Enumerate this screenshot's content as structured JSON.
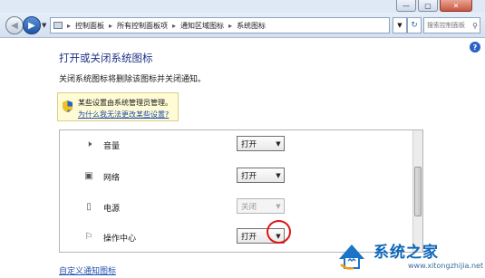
{
  "window": {
    "minimize_glyph": "—",
    "maximize_glyph": "▢",
    "close_glyph": "✕"
  },
  "address_bar": {
    "breadcrumbs": [
      "控制面板",
      "所有控制面板项",
      "通知区域图标",
      "系统图标"
    ],
    "separator": "▸",
    "search_placeholder": "搜索控制面板"
  },
  "page": {
    "title": "打开或关闭系统图标",
    "description": "关闭系统图标将删除该图标并关闭通知。",
    "notice_text": "某些设置由系统管理员管理。",
    "notice_link": "为什么我无法更改某些设置?",
    "customize_link": "自定义通知图标"
  },
  "rows": [
    {
      "label": "音量",
      "value": "打开",
      "icon": "speaker-icon",
      "enabled": true
    },
    {
      "label": "网络",
      "value": "打开",
      "icon": "network-icon",
      "enabled": true
    },
    {
      "label": "电源",
      "value": "关闭",
      "icon": "power-icon",
      "enabled": false
    },
    {
      "label": "操作中心",
      "value": "打开",
      "icon": "flag-icon",
      "enabled": true
    }
  ],
  "watermark": {
    "brand": "系统之家",
    "url": "www.xitongzhijia.net"
  },
  "colors": {
    "heading": "#1e3287",
    "link": "#1f4eb0",
    "notice_bg": "#fffbd5",
    "highlight_circle": "#e01515"
  }
}
